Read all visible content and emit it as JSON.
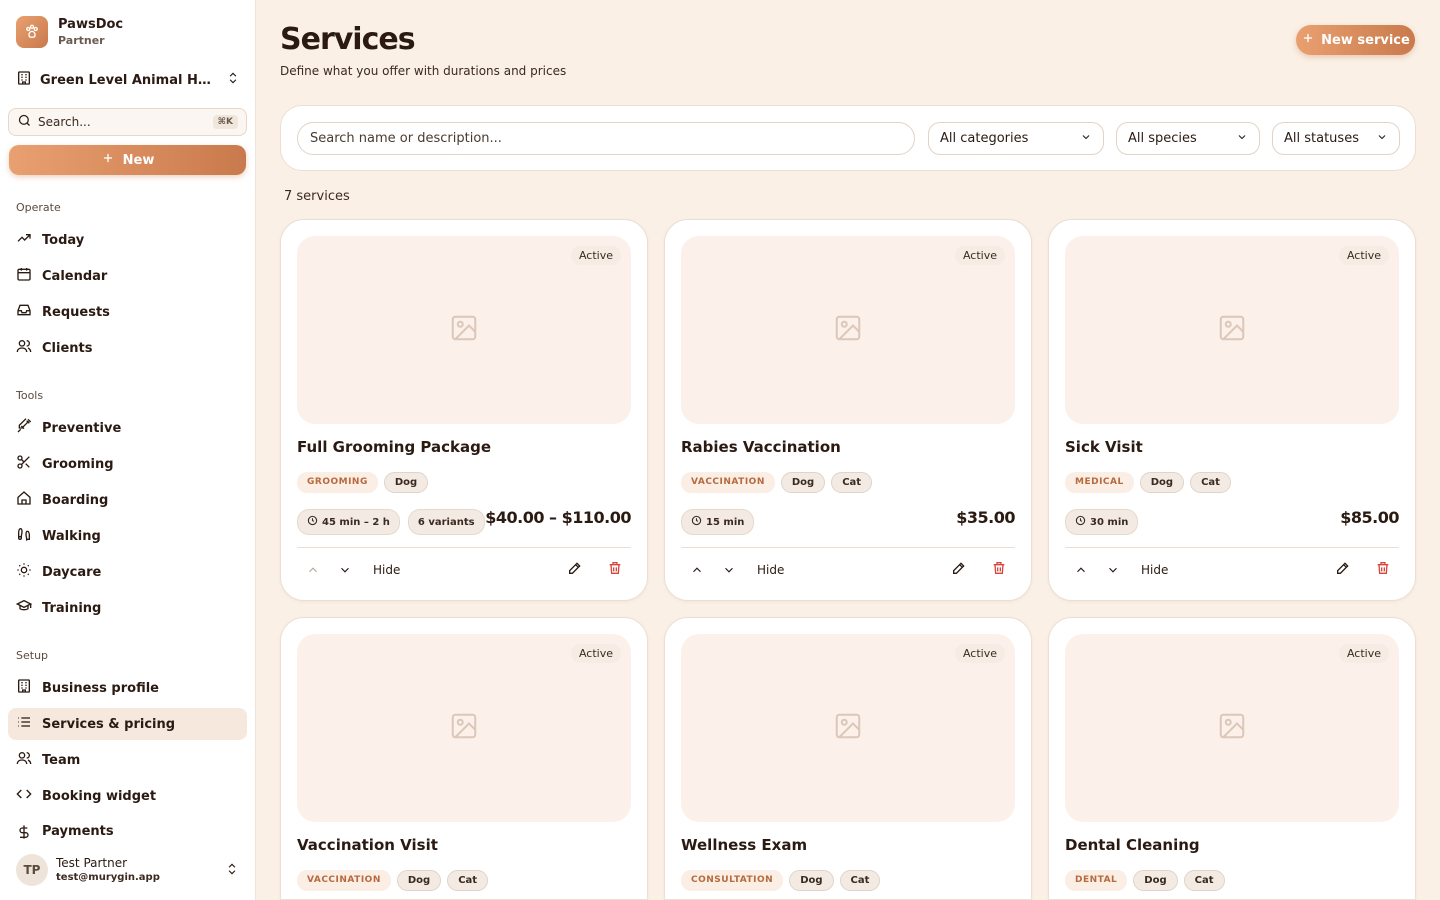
{
  "brand": {
    "name": "PawsDoc",
    "sub": "Partner"
  },
  "location": {
    "label": "Green Level Animal Hos..."
  },
  "sidebar_search": {
    "placeholder": "Search...",
    "shortcut": "⌘K"
  },
  "sidebar_new": {
    "label": "New"
  },
  "sections": {
    "operate": "Operate",
    "tools": "Tools",
    "setup": "Setup"
  },
  "nav": {
    "today": "Today",
    "calendar": "Calendar",
    "requests": "Requests",
    "clients": "Clients",
    "preventive": "Preventive",
    "grooming": "Grooming",
    "boarding": "Boarding",
    "walking": "Walking",
    "daycare": "Daycare",
    "training": "Training",
    "business_profile": "Business profile",
    "services_pricing": "Services & pricing",
    "team": "Team",
    "booking_widget": "Booking widget",
    "payments": "Payments"
  },
  "user": {
    "initials": "TP",
    "name": "Test Partner",
    "email": "test@murygin.app"
  },
  "header": {
    "title": "Services",
    "subtitle": "Define what you offer with durations and prices",
    "new_button": "New service"
  },
  "filters": {
    "search_placeholder": "Search name or description...",
    "category": "All categories",
    "species": "All species",
    "status": "All statuses"
  },
  "count_label": "7 services",
  "card_labels": {
    "hide": "Hide"
  },
  "services": [
    {
      "status": "Active",
      "name": "Full Grooming Package",
      "category": "GROOMING",
      "species": [
        "Dog"
      ],
      "duration": "45 min – 2 h",
      "variants": "6 variants",
      "price": "$40.00 – $110.00"
    },
    {
      "status": "Active",
      "name": "Rabies Vaccination",
      "category": "VACCINATION",
      "species": [
        "Dog",
        "Cat"
      ],
      "duration": "15 min",
      "price": "$35.00"
    },
    {
      "status": "Active",
      "name": "Sick Visit",
      "category": "MEDICAL",
      "species": [
        "Dog",
        "Cat"
      ],
      "duration": "30 min",
      "price": "$85.00"
    },
    {
      "status": "Active",
      "name": "Vaccination Visit",
      "category": "VACCINATION",
      "species": [
        "Dog",
        "Cat"
      ]
    },
    {
      "status": "Active",
      "name": "Wellness Exam",
      "category": "CONSULTATION",
      "species": [
        "Dog",
        "Cat"
      ]
    },
    {
      "status": "Active",
      "name": "Dental Cleaning",
      "category": "DENTAL",
      "species": [
        "Dog",
        "Cat"
      ]
    }
  ],
  "colors": {
    "accent": "#d98a5a",
    "danger": "#d9453a",
    "background": "#faf0e6"
  }
}
